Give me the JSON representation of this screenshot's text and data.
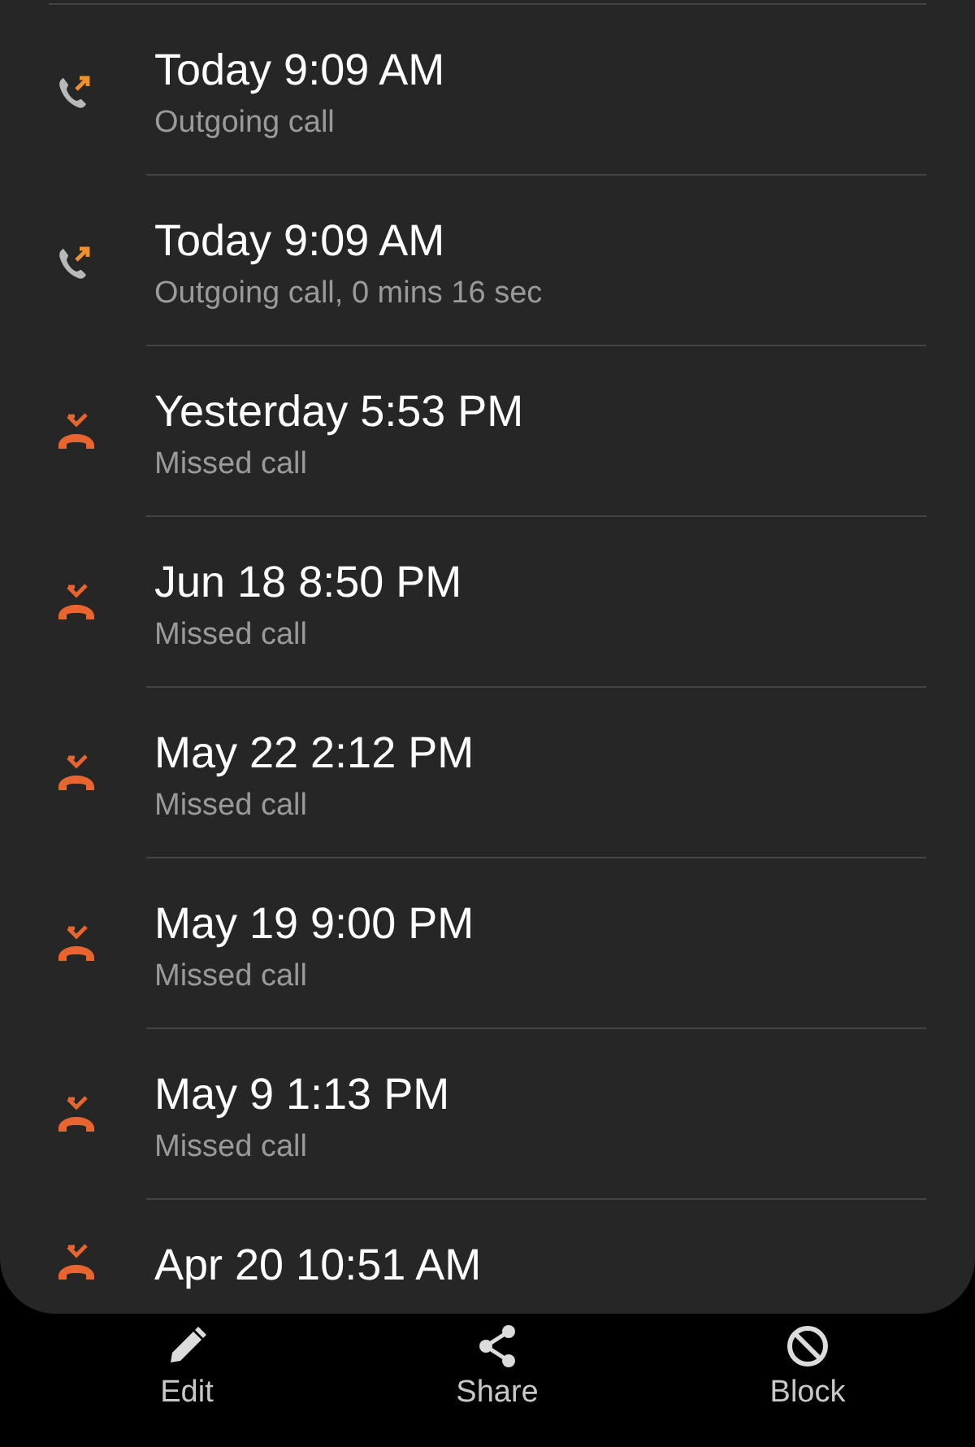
{
  "calls": [
    {
      "kind": "outgoing",
      "time": "Today 9:09 AM",
      "detail": "Outgoing call"
    },
    {
      "kind": "outgoing",
      "time": "Today 9:09 AM",
      "detail": "Outgoing call, 0 mins 16 sec"
    },
    {
      "kind": "missed",
      "time": "Yesterday 5:53 PM",
      "detail": "Missed call"
    },
    {
      "kind": "missed",
      "time": "Jun 18 8:50 PM",
      "detail": "Missed call"
    },
    {
      "kind": "missed",
      "time": "May 22 2:12 PM",
      "detail": "Missed call"
    },
    {
      "kind": "missed",
      "time": "May 19 9:00 PM",
      "detail": "Missed call"
    },
    {
      "kind": "missed",
      "time": "May 9 1:13 PM",
      "detail": "Missed call"
    },
    {
      "kind": "missed",
      "time": "Apr 20 10:51 AM"
    }
  ],
  "actions": [
    {
      "kind": "edit",
      "label": "Edit"
    },
    {
      "kind": "share",
      "label": "Share"
    },
    {
      "kind": "block",
      "label": "Block"
    }
  ]
}
